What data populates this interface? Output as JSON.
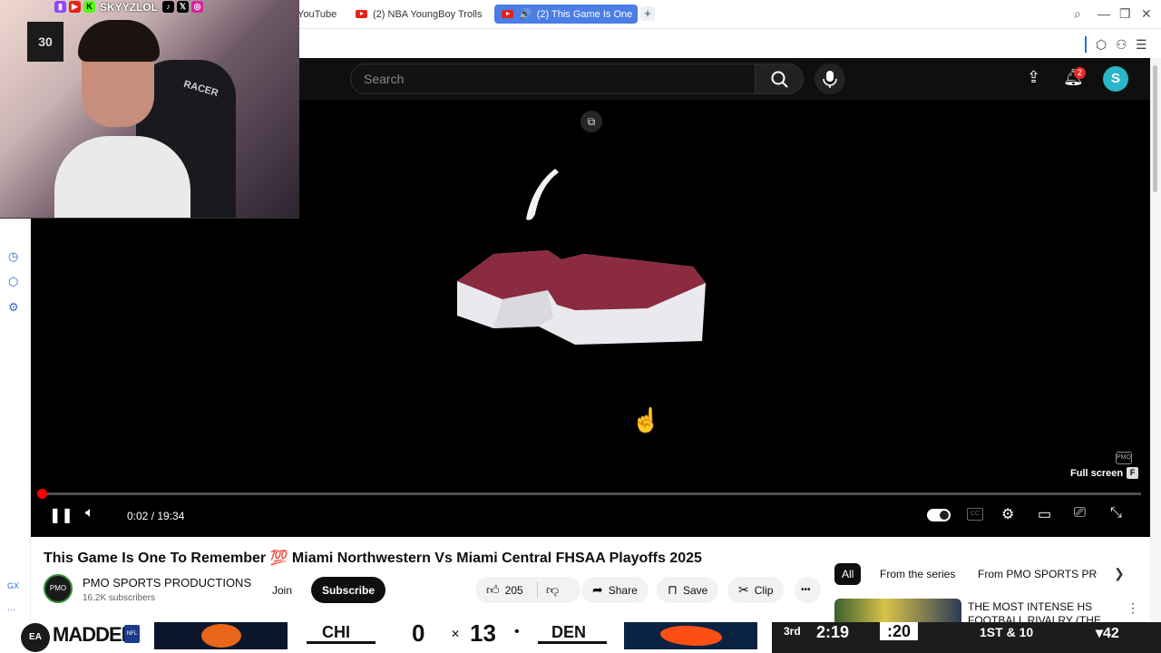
{
  "browser": {
    "tabs": [
      {
        "label": "YouTube"
      },
      {
        "label": "(2) NBA YoungBoy Trolls"
      },
      {
        "label": "(2) This Game Is One"
      }
    ],
    "new_tab": "+",
    "window_controls": {
      "search": "⌕",
      "minimize": "—",
      "restore": "❐",
      "close": "✕"
    },
    "toolbar": {
      "extensions_icon": "puzzle-icon",
      "account_icon": "person-icon",
      "menu_icon": "menu-icon"
    }
  },
  "youtube_header": {
    "search_placeholder": "Search",
    "notifications_count": "2",
    "avatar_letter": "S"
  },
  "webcam": {
    "handle": "SKYYZLOL",
    "jersey_number": "30",
    "chair_brand": "RACER"
  },
  "player": {
    "current_time": "0:02",
    "duration": "19:34",
    "time_display": "0:02 / 19:34",
    "progress_fraction": 0.0017,
    "watermark": "PMO",
    "fullscreen_tooltip": "Full screen",
    "fullscreen_key": "F",
    "cc_label": "CC"
  },
  "video": {
    "title": "This Game Is One To Remember 💯 Miami Northwestern Vs Miami Central FHSAA Playoffs 2025",
    "channel_name": "PMO SPORTS PRODUCTIONS",
    "channel_avatar_text": "PMO",
    "subscribers": "16.2K subscribers",
    "join_label": "Join",
    "subscribe_label": "Subscribe",
    "like_count": "205",
    "share_label": "Share",
    "save_label": "Save",
    "clip_label": "Clip",
    "more_label": "•••"
  },
  "recommendations": {
    "chips": [
      "All",
      "From the series",
      "From PMO SPORTS PRO"
    ],
    "first_title": "THE MOST INTENSE HS FOOTBALL RIVALRY (THE"
  },
  "sidebar_labels": {
    "top": "GX",
    "bottom": "···"
  },
  "scoreboard": {
    "brand": "MADDEN",
    "ea_label": "EA",
    "nfl_label": "NFL",
    "away_team": "CHI",
    "away_score": "0",
    "home_score": "13",
    "home_team": "DEN",
    "quarter": "3rd",
    "clock": "2:19",
    "play_clock": ":20",
    "down_distance": "1ST & 10",
    "ball_on": "▾42",
    "colors": {
      "bears_orange": "#e8651a",
      "broncos_orange": "#fb4f14",
      "broncos_navy": "#0a2343"
    }
  }
}
